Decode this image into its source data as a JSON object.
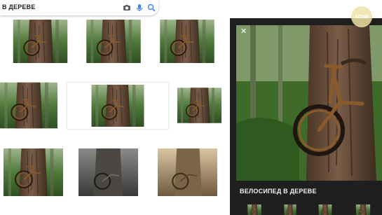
{
  "search": {
    "query": "В ДЕРЕВЕ"
  },
  "icons": {
    "camera": "camera-icon",
    "mic": "mic-icon",
    "search": "search-icon",
    "close": "close-icon"
  },
  "panel": {
    "title": "ВЕЛОСИПЕД В ДЕРЕВЕ",
    "close_glyph": "✕"
  },
  "watermark": {
    "text": "ADME"
  },
  "colors": {
    "panel_bg": "#1f1f1f",
    "bark": "#6b4f3a",
    "foliage": "#3f6a2c",
    "rust": "#8b5a2b"
  }
}
